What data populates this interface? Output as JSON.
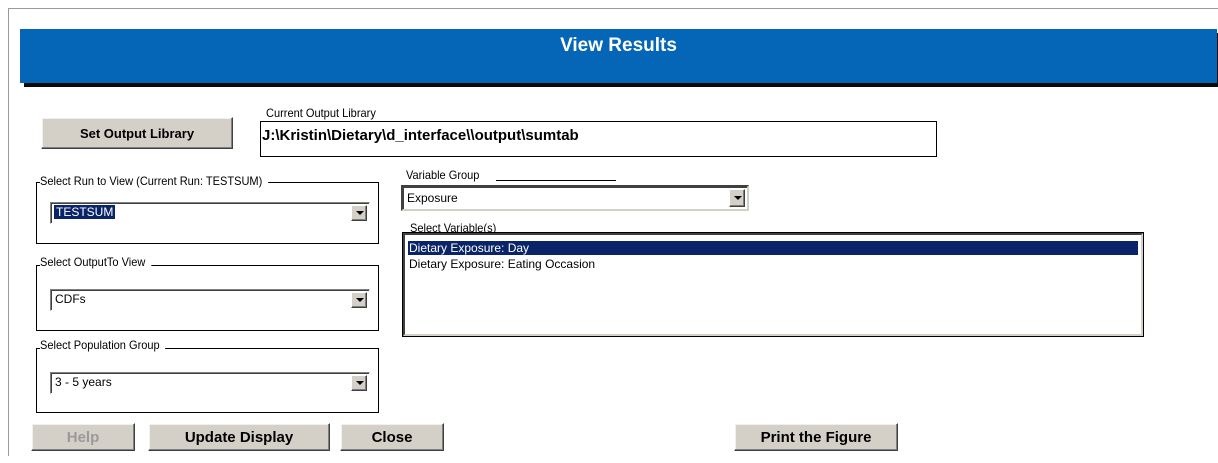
{
  "window": {
    "title": "View Results"
  },
  "output_library": {
    "button_label": "Set Output Library",
    "group_label": "Current Output Library",
    "path": "J:\\Kristin\\Dietary\\d_interface\\\\output\\sumtab"
  },
  "run": {
    "group_label": "Select Run to View (Current Run: TESTSUM)",
    "selected": "TESTSUM"
  },
  "output_to_view": {
    "group_label": "Select OutputTo View",
    "selected": "CDFs"
  },
  "population": {
    "group_label": "Select Population Group",
    "selected": "3 - 5 years"
  },
  "variable_group": {
    "label": "Variable Group",
    "selected": "Exposure"
  },
  "variables": {
    "label": "Select Variable(s)",
    "items": [
      {
        "label": "Dietary Exposure: Day",
        "selected": true
      },
      {
        "label": "Dietary Exposure: Eating Occasion",
        "selected": false
      }
    ]
  },
  "buttons": {
    "help": "Help",
    "update": "Update Display",
    "close": "Close",
    "print": "Print the Figure"
  },
  "colors": {
    "title_bar": "#0566b8",
    "selection": "#0a246a",
    "button_face": "#d4d0c8"
  }
}
